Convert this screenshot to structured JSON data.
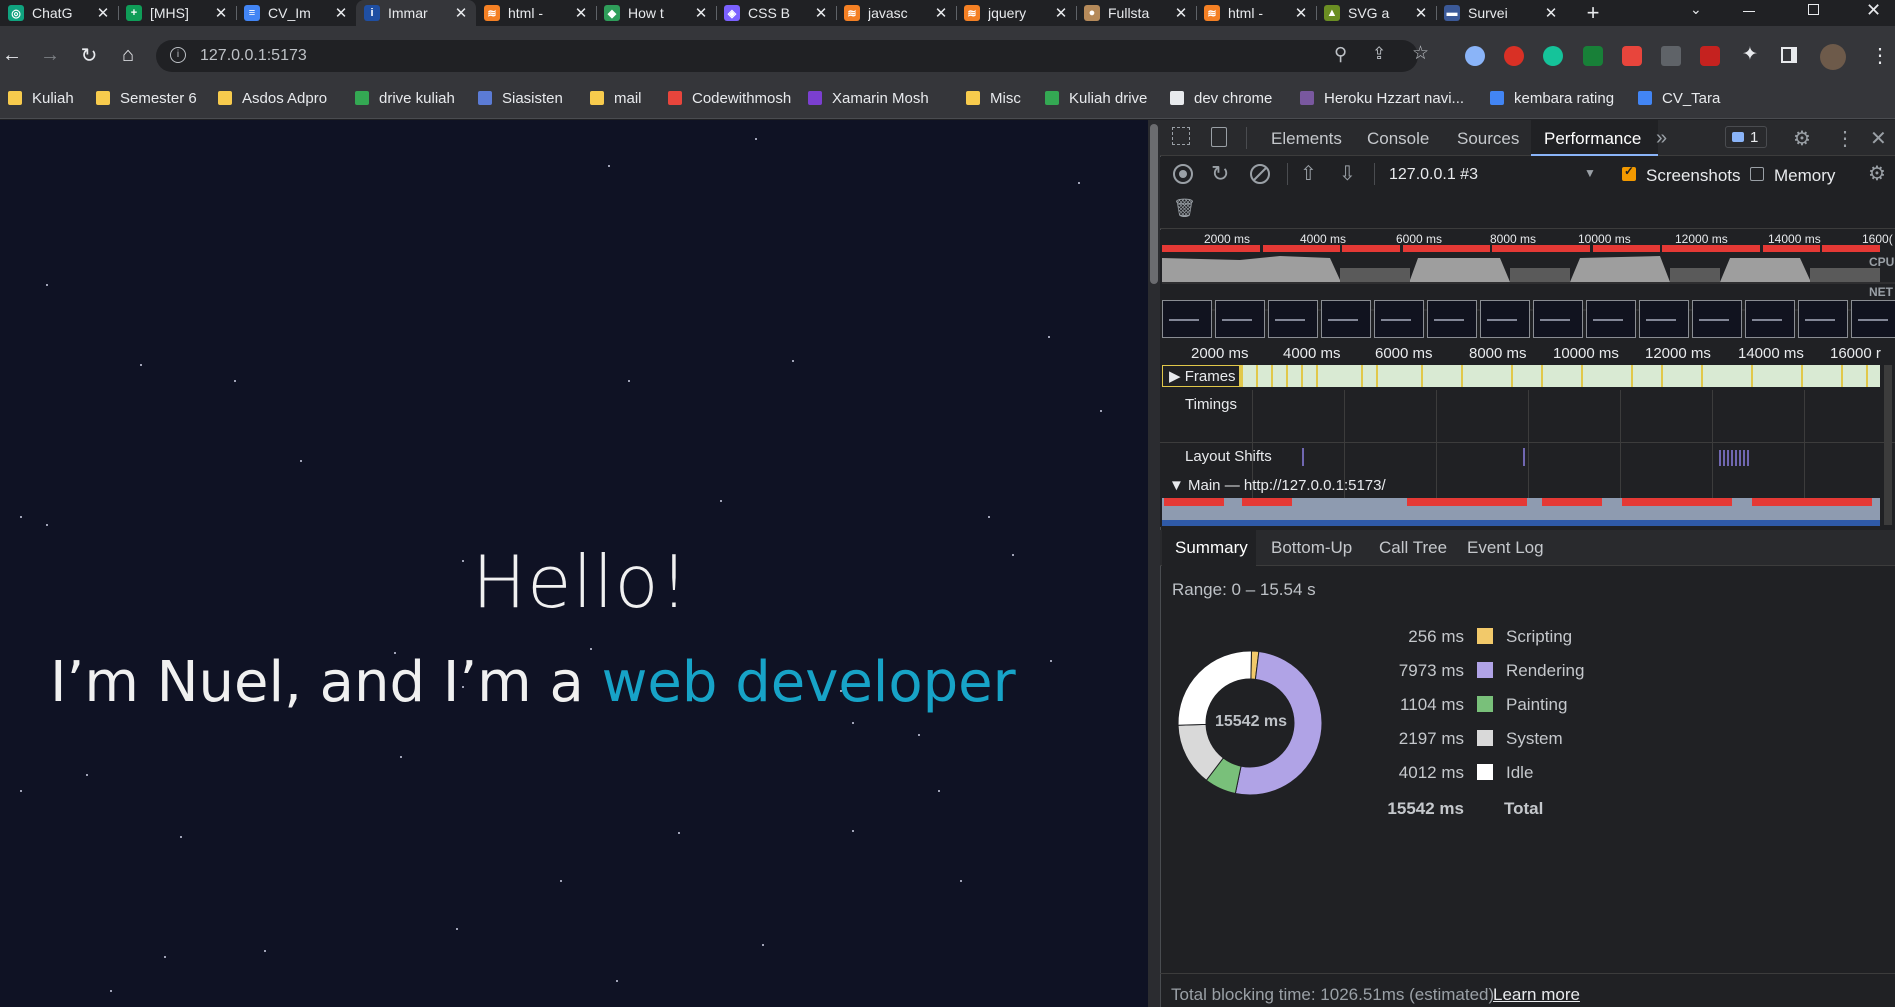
{
  "tabs": [
    {
      "title": "ChatG",
      "fav": "#10a37f",
      "glyph": "◎"
    },
    {
      "title": "[MHS]",
      "fav": "#0f9d58",
      "glyph": "+"
    },
    {
      "title": "CV_Im",
      "fav": "#4285f4",
      "glyph": "≡"
    },
    {
      "title": "Immar",
      "fav": "#1f4fa3",
      "glyph": "i"
    },
    {
      "title": "html -",
      "fav": "#f48024",
      "glyph": "≋"
    },
    {
      "title": "How t",
      "fav": "#2f9e5a",
      "glyph": "◆"
    },
    {
      "title": "CSS B",
      "fav": "#7b61ff",
      "glyph": "◈"
    },
    {
      "title": "javasc",
      "fav": "#f48024",
      "glyph": "≋"
    },
    {
      "title": "jquery",
      "fav": "#f48024",
      "glyph": "≋"
    },
    {
      "title": "Fullsta",
      "fav": "#b58a5a",
      "glyph": "●"
    },
    {
      "title": "html -",
      "fav": "#f48024",
      "glyph": "≋"
    },
    {
      "title": "SVG a",
      "fav": "#6b8e23",
      "glyph": "▲"
    },
    {
      "title": "Survei",
      "fav": "#3b5998",
      "glyph": "▬"
    }
  ],
  "address": {
    "url": "127.0.0.1:5173"
  },
  "bookmarks": [
    {
      "label": "Kuliah",
      "color": "#f7cb4d"
    },
    {
      "label": "Semester 6",
      "color": "#f7cb4d"
    },
    {
      "label": "Asdos Adpro",
      "color": "#f7cb4d"
    },
    {
      "label": "drive kuliah",
      "color": "#34a853"
    },
    {
      "label": "Siasisten",
      "color": "#5b7bd5"
    },
    {
      "label": "mail",
      "color": "#f7cb4d"
    },
    {
      "label": "Codewithmosh",
      "color": "#e8453c"
    },
    {
      "label": "Xamarin Mosh",
      "color": "#7b3fd0"
    },
    {
      "label": "Misc",
      "color": "#f7cb4d"
    },
    {
      "label": "Kuliah drive",
      "color": "#34a853"
    },
    {
      "label": "dev chrome",
      "color": "#e8eaed"
    },
    {
      "label": "Heroku Hzzart navi...",
      "color": "#79589f"
    },
    {
      "label": "kembara rating",
      "color": "#4285f4"
    },
    {
      "label": "CV_Tara",
      "color": "#4285f4"
    }
  ],
  "page": {
    "greeting": "Hello!",
    "intro_prefix": "I’m Nuel, and I’m a ",
    "intro_highlight": "web developer"
  },
  "devtools": {
    "tabs": [
      "Elements",
      "Console",
      "Sources",
      "Performance"
    ],
    "issues_count": "1",
    "recording": "127.0.0.1 #3",
    "screenshots_label": "Screenshots",
    "memory_label": "Memory",
    "overview_ticks": [
      "2000 ms",
      "4000 ms",
      "6000 ms",
      "8000 ms",
      "10000 ms",
      "12000 ms",
      "14000 ms",
      "1600("
    ],
    "cpu_label": "CPU",
    "net_label": "NET",
    "timeline_ticks": [
      "2000 ms",
      "4000 ms",
      "6000 ms",
      "8000 ms",
      "10000 ms",
      "12000 ms",
      "14000 ms",
      "16000 r"
    ],
    "tracks": {
      "frames": "Frames",
      "timings": "Timings",
      "layout_shifts": "Layout Shifts",
      "main": "Main — http://127.0.0.1:5173/"
    },
    "bottom_tabs": [
      "Summary",
      "Bottom-Up",
      "Call Tree",
      "Event Log"
    ],
    "range": "Range: 0 – 15.54 s",
    "donut_center": "15542 ms",
    "summary": [
      {
        "value": "256 ms",
        "label": "Scripting",
        "color": "#f2c96a",
        "ms": 256
      },
      {
        "value": "7973 ms",
        "label": "Rendering",
        "color": "#b0a3e6",
        "ms": 7973
      },
      {
        "value": "1104 ms",
        "label": "Painting",
        "color": "#79c07a",
        "ms": 1104
      },
      {
        "value": "2197 ms",
        "label": "System",
        "color": "#d9d9d9",
        "ms": 2197
      },
      {
        "value": "4012 ms",
        "label": "Idle",
        "color": "#ffffff",
        "ms": 4012
      }
    ],
    "total_value": "15542 ms",
    "total_label": "Total",
    "footer": "Total blocking time: 1026.51ms (estimated)",
    "learn_more": "Learn more"
  }
}
